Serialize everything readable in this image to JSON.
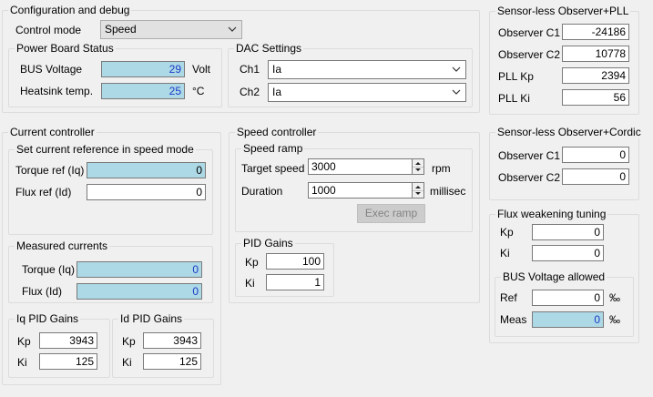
{
  "config": {
    "title": "Configuration and debug",
    "control_mode_label": "Control mode",
    "control_mode_value": "Speed",
    "power_board": {
      "title": "Power Board Status",
      "bus_voltage_label": "BUS Voltage",
      "bus_voltage_value": "29",
      "bus_voltage_unit": "Volt",
      "heatsink_label": "Heatsink temp.",
      "heatsink_value": "25",
      "heatsink_unit": "°C"
    },
    "dac": {
      "title": "DAC Settings",
      "ch1_label": "Ch1",
      "ch1_value": "Ia",
      "ch2_label": "Ch2",
      "ch2_value": "Ia"
    }
  },
  "observer_pll": {
    "title": "Sensor-less Observer+PLL",
    "c1_label": "Observer C1",
    "c1_value": "-24186",
    "c2_label": "Observer C2",
    "c2_value": "10778",
    "kp_label": "PLL Kp",
    "kp_value": "2394",
    "ki_label": "PLL Ki",
    "ki_value": "56"
  },
  "current_controller": {
    "title": "Current controller",
    "reference": {
      "title": "Set current reference in speed mode",
      "torque_label": "Torque ref (Iq)",
      "torque_value": "0",
      "flux_label": "Flux ref (Id)",
      "flux_value": "0"
    },
    "measured": {
      "title": "Measured currents",
      "torque_label": "Torque (Iq)",
      "torque_value": "0",
      "flux_label": "Flux (Id)",
      "flux_value": "0"
    },
    "iq_pid": {
      "title": "Iq PID Gains",
      "kp_label": "Kp",
      "kp_value": "3943",
      "ki_label": "Ki",
      "ki_value": "125"
    },
    "id_pid": {
      "title": "Id PID Gains",
      "kp_label": "Kp",
      "kp_value": "3943",
      "ki_label": "Ki",
      "ki_value": "125"
    }
  },
  "speed_controller": {
    "title": "Speed controller",
    "ramp": {
      "title": "Speed ramp",
      "target_label": "Target speed",
      "target_value": "3000",
      "target_unit": "rpm",
      "duration_label": "Duration",
      "duration_value": "1000",
      "duration_unit": "millisec",
      "exec_label": "Exec ramp"
    },
    "pid": {
      "title": "PID Gains",
      "kp_label": "Kp",
      "kp_value": "100",
      "ki_label": "Ki",
      "ki_value": "1"
    }
  },
  "observer_cordic": {
    "title": "Sensor-less Observer+Cordic",
    "c1_label": "Observer C1",
    "c1_value": "0",
    "c2_label": "Observer C2",
    "c2_value": "0"
  },
  "flux_weakening": {
    "title": "Flux weakening tuning",
    "kp_label": "Kp",
    "kp_value": "0",
    "ki_label": "Ki",
    "ki_value": "0",
    "bus_voltage": {
      "title": "BUS Voltage allowed",
      "ref_label": "Ref",
      "ref_value": "0",
      "meas_label": "Meas",
      "meas_value": "0",
      "unit": "‰"
    }
  },
  "colors": {
    "readonly_bg": "#add8e6",
    "value_blue": "#1a3cc8",
    "disabled_button_bg": "#cccccc"
  },
  "icons": [
    "chevron-down-icon",
    "spin-up-icon",
    "spin-down-icon"
  ]
}
